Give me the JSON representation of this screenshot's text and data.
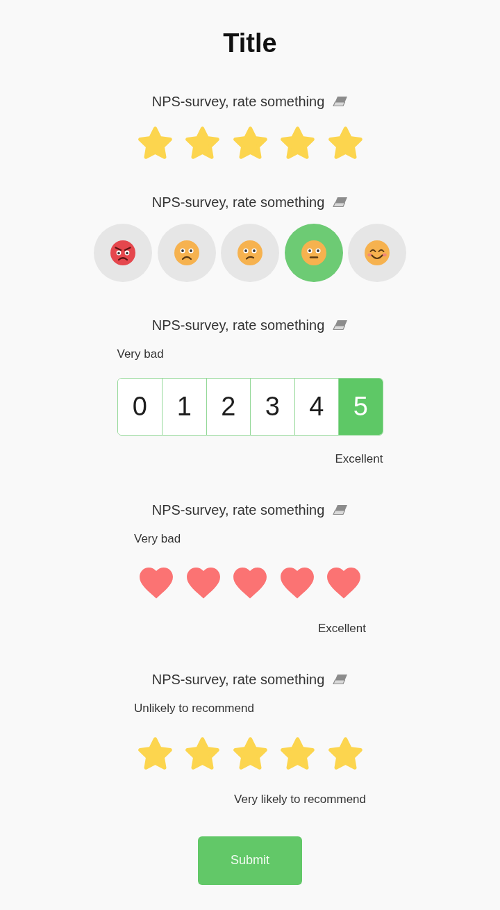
{
  "title": "Title",
  "questions": [
    {
      "kind": "stars",
      "label": "NPS-survey, rate something",
      "stars": 5
    },
    {
      "kind": "faces",
      "label": "NPS-survey, rate something",
      "options": [
        {
          "kind": "angry",
          "selected": false
        },
        {
          "kind": "sad",
          "selected": false
        },
        {
          "kind": "worried",
          "selected": false
        },
        {
          "kind": "neutral",
          "selected": true
        },
        {
          "kind": "happy",
          "selected": false
        }
      ]
    },
    {
      "kind": "scale",
      "label": "NPS-survey, rate something",
      "min_label": "Very bad",
      "max_label": "Excellent",
      "options": [
        {
          "label": "0",
          "selected": false
        },
        {
          "label": "1",
          "selected": false
        },
        {
          "label": "2",
          "selected": false
        },
        {
          "label": "3",
          "selected": false
        },
        {
          "label": "4",
          "selected": false
        },
        {
          "label": "5",
          "selected": true
        }
      ]
    },
    {
      "kind": "hearts",
      "label": "NPS-survey, rate something",
      "min_label": "Very bad",
      "max_label": "Excellent",
      "stars": 5
    },
    {
      "kind": "stars",
      "label": "NPS-survey, rate something",
      "min_label": "Unlikely to recommend",
      "max_label": "Very likely to recommend",
      "stars": 5
    }
  ],
  "submit_button": {
    "label": "Submit"
  }
}
